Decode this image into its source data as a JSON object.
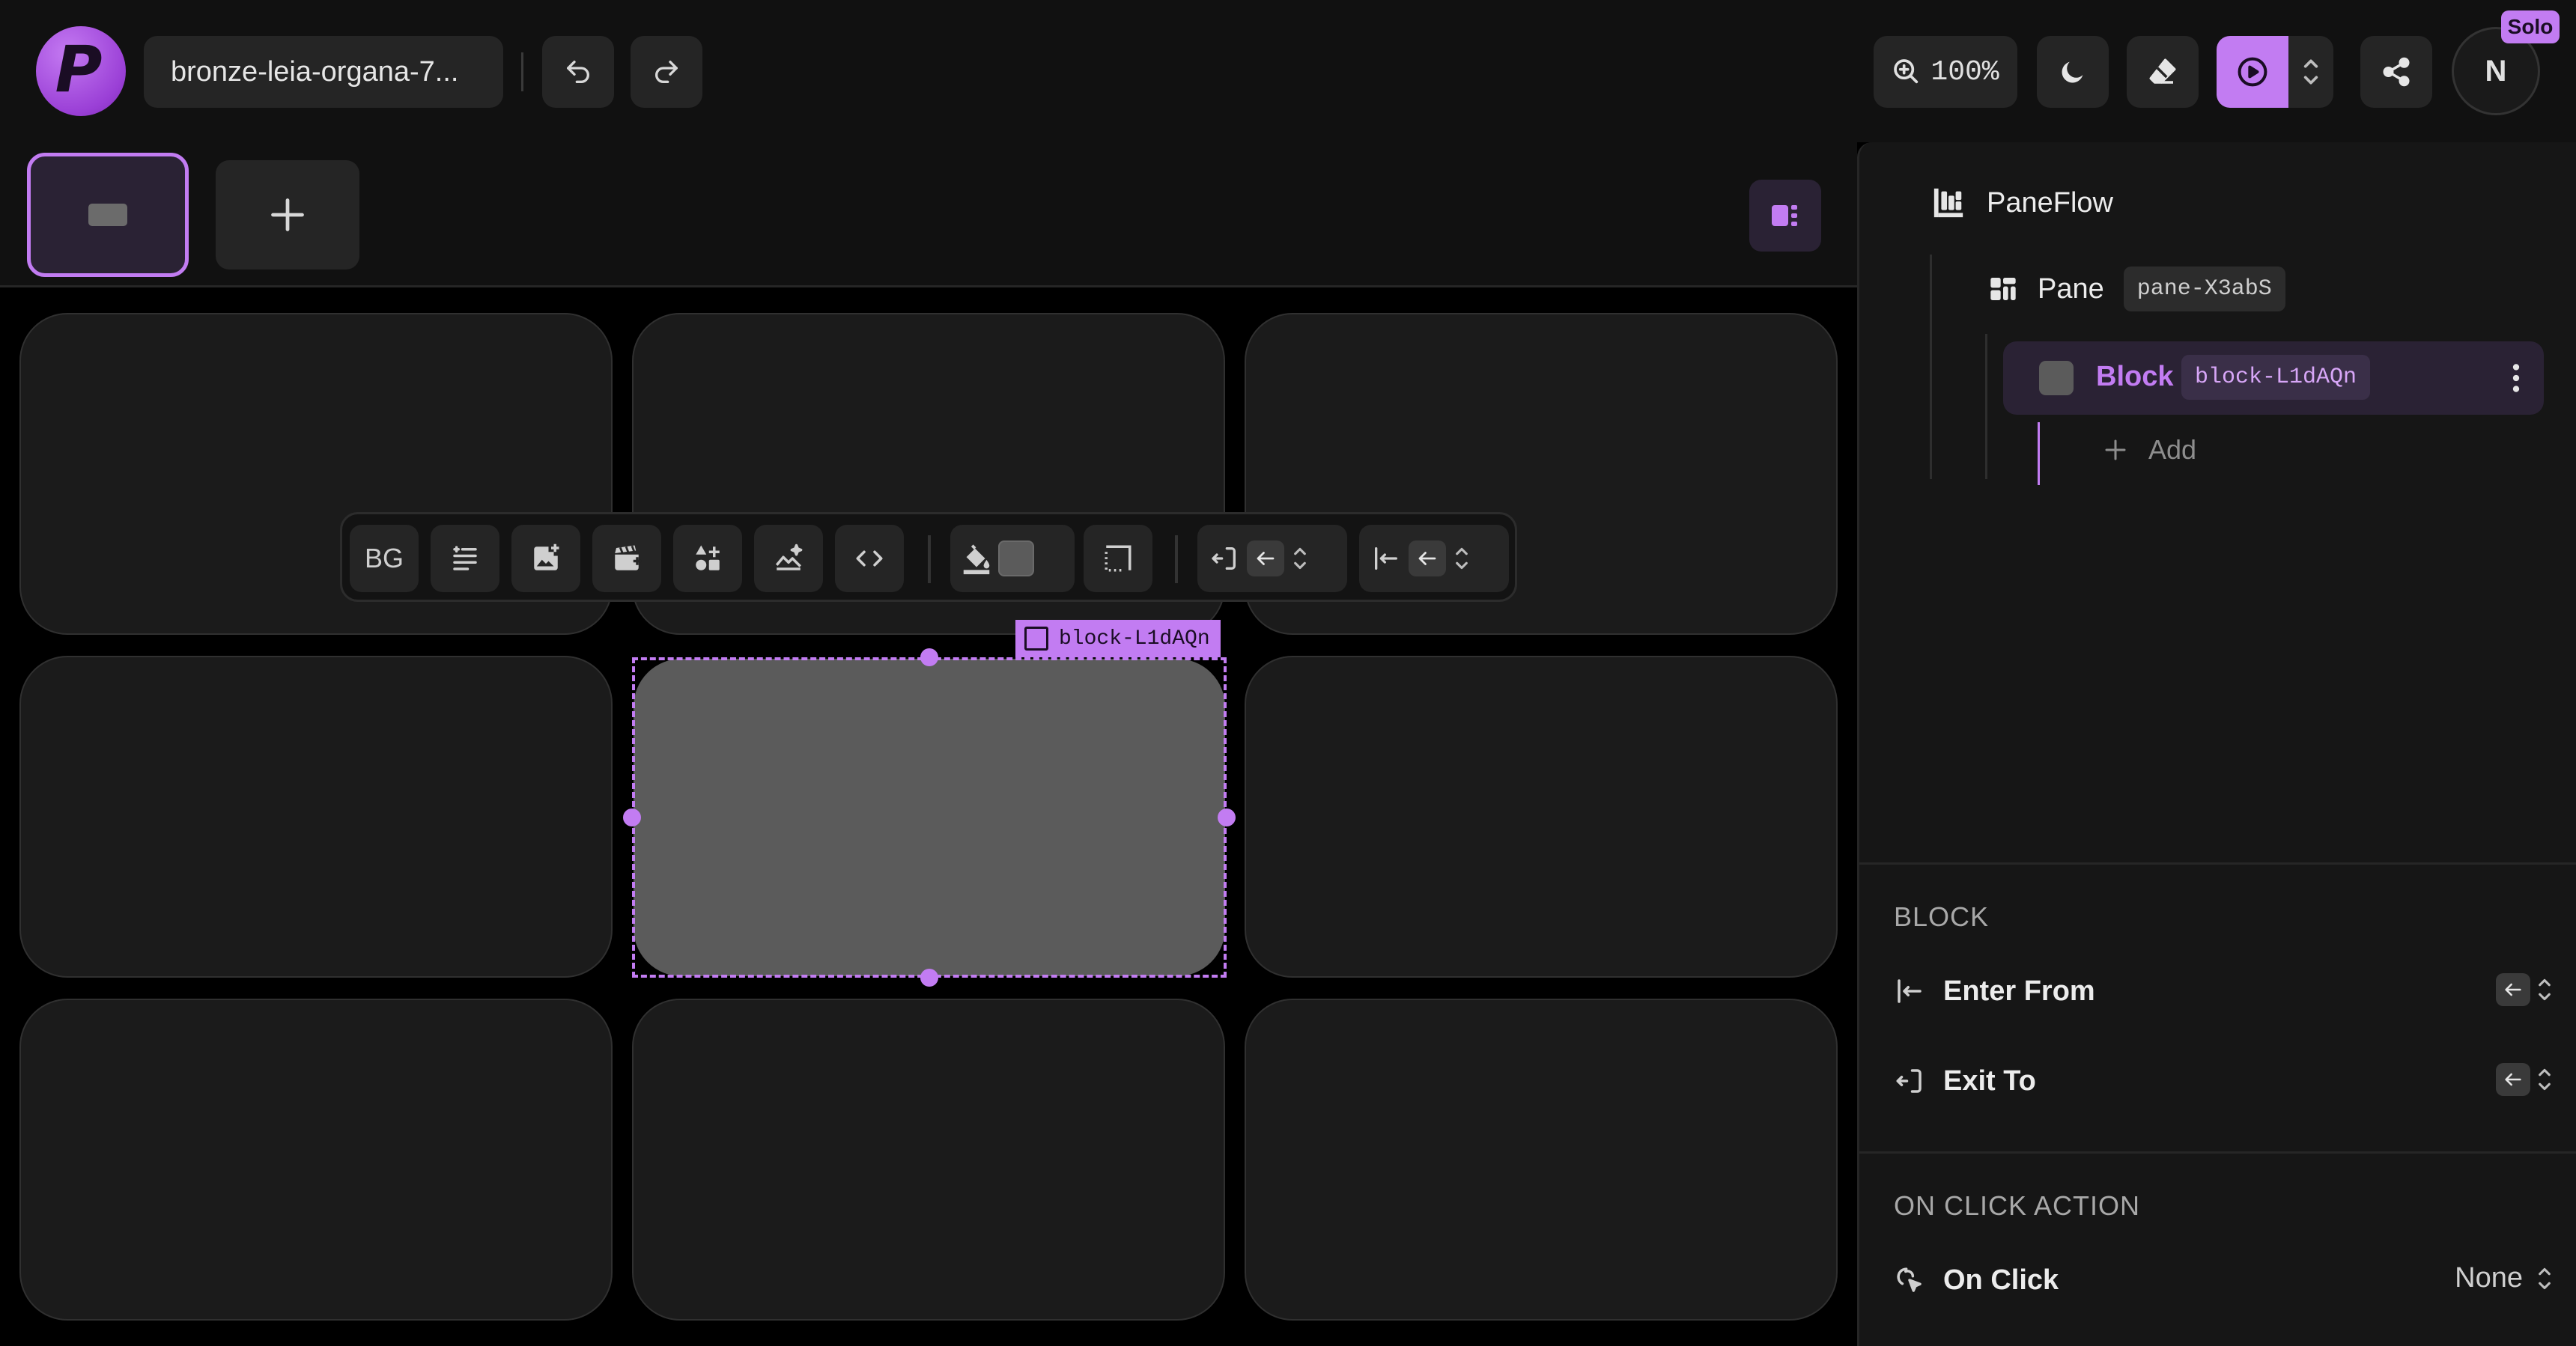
{
  "app": {
    "logo_letter": "P",
    "project_name": "bronze-leia-organa-7...",
    "zoom": "100%",
    "avatar_initial": "N",
    "solo_badge": "Solo"
  },
  "toolbar": {
    "bg_label": "BG"
  },
  "canvas": {
    "selected_block_id": "block-L1dAQn"
  },
  "panel": {
    "tree": {
      "root_label": "PaneFlow",
      "pane_label": "Pane",
      "pane_id": "pane-X3abS",
      "block_label": "Block",
      "block_id": "block-L1dAQn",
      "add_label": "Add"
    },
    "block_section": {
      "title": "BLOCK",
      "enter_from_label": "Enter From",
      "exit_to_label": "Exit To"
    },
    "click_section": {
      "title": "ON CLICK ACTION",
      "on_click_label": "On Click",
      "on_click_value": "None"
    }
  },
  "colors": {
    "accent": "#c27cf2",
    "background": "#000000",
    "surface": "#1b1b1b",
    "selected_block": "#5b5b5b"
  }
}
